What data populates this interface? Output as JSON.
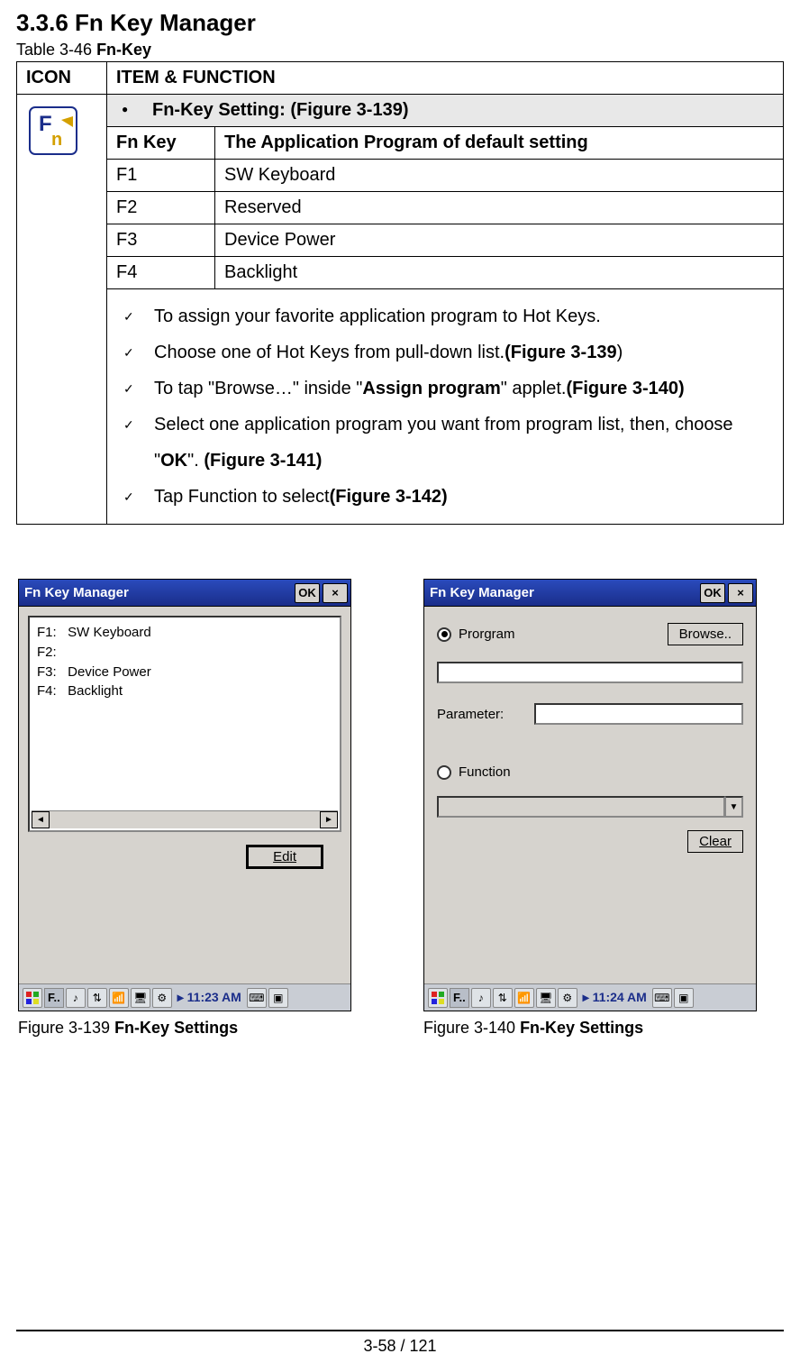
{
  "section_title": "3.3.6 Fn Key Manager",
  "table_caption_prefix": "Table 3-46 ",
  "table_caption_bold": "Fn-Key",
  "table": {
    "header_icon": "ICON",
    "header_item": "ITEM & FUNCTION",
    "section_label": "Fn-Key Setting: (Figure 3-139)",
    "col_key": "Fn Key",
    "col_app": "The Application Program of default setting",
    "rows": [
      {
        "key": "F1",
        "app": "SW Keyboard"
      },
      {
        "key": "F2",
        "app": "Reserved"
      },
      {
        "key": "F3",
        "app": "Device Power"
      },
      {
        "key": "F4",
        "app": "Backlight"
      }
    ],
    "notes": [
      {
        "pre": "To assign your favorite application program to Hot Keys."
      },
      {
        "pre": "Choose one of Hot Keys from pull-down list.",
        "bold": "(Figure 3-139",
        "post": ")"
      },
      {
        "pre": "To tap \"Browse…\" inside \"",
        "bold": "Assign program",
        "mid": "\" applet.",
        "bold2": "(Figure 3-140)"
      },
      {
        "pre": "Select one application program you want from program list, then, choose \"",
        "bold": "OK",
        "mid": "\". ",
        "bold2": "(Figure 3-141)"
      },
      {
        "pre": "Tap Function to select",
        "bold": "(Figure 3-142)"
      }
    ]
  },
  "figure_left": {
    "window_title": "Fn Key Manager",
    "ok_label": "OK",
    "close_glyph": "×",
    "list_lines": [
      "F1:   SW Keyboard",
      "F2:",
      "F3:   Device Power",
      "F4:   Backlight"
    ],
    "edit_label": "Edit",
    "taskbar": {
      "running_label": "F..",
      "time": "11:23 AM"
    },
    "caption_prefix": "Figure 3-139 ",
    "caption_bold": "Fn-Key Settings"
  },
  "figure_right": {
    "window_title": "Fn Key Manager",
    "ok_label": "OK",
    "close_glyph": "×",
    "program_label": "Prorgram",
    "browse_label": "Browse..",
    "parameter_label": "Parameter:",
    "function_label": "Function",
    "clear_label": "Clear",
    "taskbar": {
      "running_label": "F..",
      "time": "11:24 AM"
    },
    "caption_prefix": "Figure 3-140 ",
    "caption_bold": "Fn-Key Settings"
  },
  "footer_text": "3-58 / 121"
}
